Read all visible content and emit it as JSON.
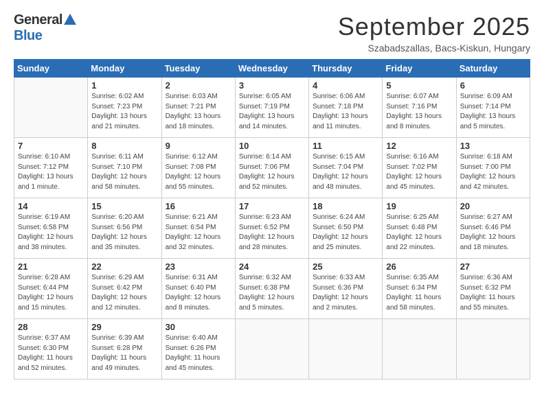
{
  "logo": {
    "general": "General",
    "blue": "Blue"
  },
  "title": "September 2025",
  "location": "Szabadszallas, Bacs-Kiskun, Hungary",
  "days_of_week": [
    "Sunday",
    "Monday",
    "Tuesday",
    "Wednesday",
    "Thursday",
    "Friday",
    "Saturday"
  ],
  "weeks": [
    [
      {
        "day": "",
        "info": ""
      },
      {
        "day": "1",
        "info": "Sunrise: 6:02 AM\nSunset: 7:23 PM\nDaylight: 13 hours\nand 21 minutes."
      },
      {
        "day": "2",
        "info": "Sunrise: 6:03 AM\nSunset: 7:21 PM\nDaylight: 13 hours\nand 18 minutes."
      },
      {
        "day": "3",
        "info": "Sunrise: 6:05 AM\nSunset: 7:19 PM\nDaylight: 13 hours\nand 14 minutes."
      },
      {
        "day": "4",
        "info": "Sunrise: 6:06 AM\nSunset: 7:18 PM\nDaylight: 13 hours\nand 11 minutes."
      },
      {
        "day": "5",
        "info": "Sunrise: 6:07 AM\nSunset: 7:16 PM\nDaylight: 13 hours\nand 8 minutes."
      },
      {
        "day": "6",
        "info": "Sunrise: 6:09 AM\nSunset: 7:14 PM\nDaylight: 13 hours\nand 5 minutes."
      }
    ],
    [
      {
        "day": "7",
        "info": "Sunrise: 6:10 AM\nSunset: 7:12 PM\nDaylight: 13 hours\nand 1 minute."
      },
      {
        "day": "8",
        "info": "Sunrise: 6:11 AM\nSunset: 7:10 PM\nDaylight: 12 hours\nand 58 minutes."
      },
      {
        "day": "9",
        "info": "Sunrise: 6:12 AM\nSunset: 7:08 PM\nDaylight: 12 hours\nand 55 minutes."
      },
      {
        "day": "10",
        "info": "Sunrise: 6:14 AM\nSunset: 7:06 PM\nDaylight: 12 hours\nand 52 minutes."
      },
      {
        "day": "11",
        "info": "Sunrise: 6:15 AM\nSunset: 7:04 PM\nDaylight: 12 hours\nand 48 minutes."
      },
      {
        "day": "12",
        "info": "Sunrise: 6:16 AM\nSunset: 7:02 PM\nDaylight: 12 hours\nand 45 minutes."
      },
      {
        "day": "13",
        "info": "Sunrise: 6:18 AM\nSunset: 7:00 PM\nDaylight: 12 hours\nand 42 minutes."
      }
    ],
    [
      {
        "day": "14",
        "info": "Sunrise: 6:19 AM\nSunset: 6:58 PM\nDaylight: 12 hours\nand 38 minutes."
      },
      {
        "day": "15",
        "info": "Sunrise: 6:20 AM\nSunset: 6:56 PM\nDaylight: 12 hours\nand 35 minutes."
      },
      {
        "day": "16",
        "info": "Sunrise: 6:21 AM\nSunset: 6:54 PM\nDaylight: 12 hours\nand 32 minutes."
      },
      {
        "day": "17",
        "info": "Sunrise: 6:23 AM\nSunset: 6:52 PM\nDaylight: 12 hours\nand 28 minutes."
      },
      {
        "day": "18",
        "info": "Sunrise: 6:24 AM\nSunset: 6:50 PM\nDaylight: 12 hours\nand 25 minutes."
      },
      {
        "day": "19",
        "info": "Sunrise: 6:25 AM\nSunset: 6:48 PM\nDaylight: 12 hours\nand 22 minutes."
      },
      {
        "day": "20",
        "info": "Sunrise: 6:27 AM\nSunset: 6:46 PM\nDaylight: 12 hours\nand 18 minutes."
      }
    ],
    [
      {
        "day": "21",
        "info": "Sunrise: 6:28 AM\nSunset: 6:44 PM\nDaylight: 12 hours\nand 15 minutes."
      },
      {
        "day": "22",
        "info": "Sunrise: 6:29 AM\nSunset: 6:42 PM\nDaylight: 12 hours\nand 12 minutes."
      },
      {
        "day": "23",
        "info": "Sunrise: 6:31 AM\nSunset: 6:40 PM\nDaylight: 12 hours\nand 8 minutes."
      },
      {
        "day": "24",
        "info": "Sunrise: 6:32 AM\nSunset: 6:38 PM\nDaylight: 12 hours\nand 5 minutes."
      },
      {
        "day": "25",
        "info": "Sunrise: 6:33 AM\nSunset: 6:36 PM\nDaylight: 12 hours\nand 2 minutes."
      },
      {
        "day": "26",
        "info": "Sunrise: 6:35 AM\nSunset: 6:34 PM\nDaylight: 11 hours\nand 58 minutes."
      },
      {
        "day": "27",
        "info": "Sunrise: 6:36 AM\nSunset: 6:32 PM\nDaylight: 11 hours\nand 55 minutes."
      }
    ],
    [
      {
        "day": "28",
        "info": "Sunrise: 6:37 AM\nSunset: 6:30 PM\nDaylight: 11 hours\nand 52 minutes."
      },
      {
        "day": "29",
        "info": "Sunrise: 6:39 AM\nSunset: 6:28 PM\nDaylight: 11 hours\nand 49 minutes."
      },
      {
        "day": "30",
        "info": "Sunrise: 6:40 AM\nSunset: 6:26 PM\nDaylight: 11 hours\nand 45 minutes."
      },
      {
        "day": "",
        "info": ""
      },
      {
        "day": "",
        "info": ""
      },
      {
        "day": "",
        "info": ""
      },
      {
        "day": "",
        "info": ""
      }
    ]
  ]
}
